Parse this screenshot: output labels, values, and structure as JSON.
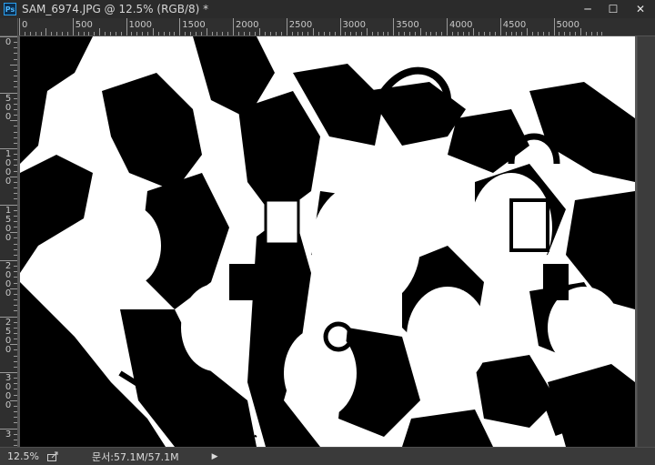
{
  "window": {
    "app_icon_label": "Ps",
    "title": "SAM_6974.JPG @ 12.5% (RGB/8) *",
    "minimize": "─",
    "maximize": "☐",
    "close": "✕"
  },
  "ruler": {
    "horizontal": [
      "0",
      "500",
      "1000",
      "1500",
      "2000",
      "2500",
      "3000",
      "3500",
      "4000",
      "4500",
      "5000"
    ],
    "vertical": [
      "0",
      "5\n0\n0",
      "1\n0\n0\n0",
      "1\n5\n0\n0",
      "2\n0\n0\n0",
      "2\n5\n0\n0",
      "3\n0\n0\n0",
      "3"
    ]
  },
  "canvas": {
    "image_name": "SAM_6974.JPG",
    "color_mode": "RGB/8",
    "background": "#ffffff",
    "foreground": "#000000"
  },
  "status": {
    "zoom": "12.5%",
    "doc_info": "문서:57.1M/57.1M",
    "arrow": "▶",
    "export_icon": "export-icon"
  },
  "colors": {
    "titlebar": "#2b2b2b",
    "ruler": "#2f2f2f",
    "status": "#3a3a3a",
    "accent": "#2aa0f0"
  }
}
